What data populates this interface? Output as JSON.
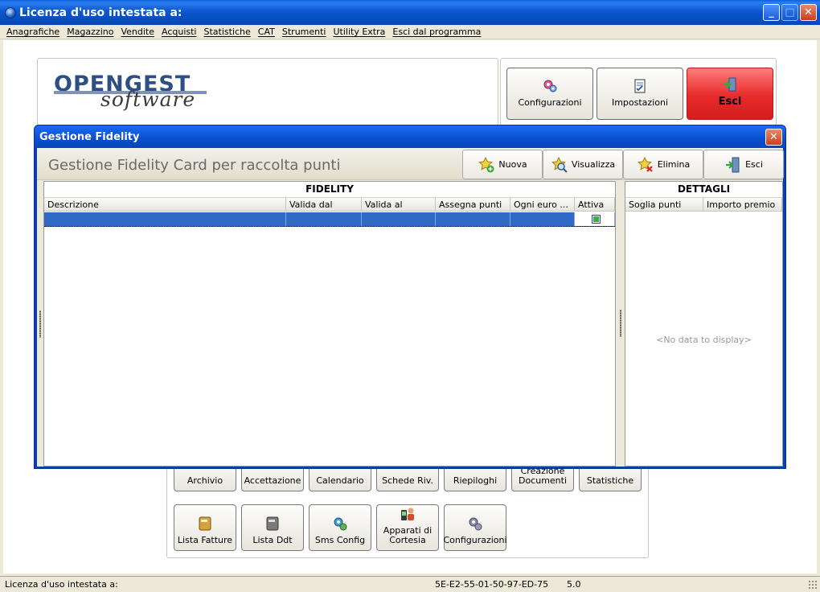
{
  "main_window": {
    "title": "Licenza d'uso intestata a:",
    "controls": {
      "minimize": "_",
      "maximize": "□",
      "close": "✕"
    }
  },
  "menu": {
    "items": [
      "Anagrafiche",
      "Magazzino",
      "Vendite",
      "Acquisti",
      "Statistiche",
      "CAT",
      "Strumenti",
      "Utility Extra",
      "Esci dal programma"
    ]
  },
  "logo": {
    "line1": "OPENGEST",
    "line2": "software"
  },
  "top_buttons": [
    {
      "label": "Configurazioni",
      "icon": "gears-icon"
    },
    {
      "label": "Impostazioni",
      "icon": "checklist-icon"
    },
    {
      "label": "Esci",
      "icon": "exit-door-icon"
    }
  ],
  "bottom_buttons": {
    "row1": [
      "Archivio",
      "Accettazione",
      "Calendario",
      "Schede Riv.",
      "Riepiloghi",
      "Creazione Documenti",
      "Statistiche"
    ],
    "row2": [
      "Lista Fatture",
      "Lista Ddt",
      "Sms Config",
      "Apparati di Cortesia",
      "Configurazioni"
    ]
  },
  "status": {
    "license": "Licenza d'uso intestata a:",
    "code": "5E-E2-55-01-50-97-ED-75",
    "version": "5.0"
  },
  "dialog": {
    "title": "Gestione Fidelity",
    "close": "✕",
    "header_title": "Gestione Fidelity Card per raccolta punti",
    "toolbar": [
      {
        "label": "Nuova",
        "icon": "star-add-icon"
      },
      {
        "label": "Visualizza",
        "icon": "star-search-icon"
      },
      {
        "label": "Elimina",
        "icon": "star-delete-icon"
      },
      {
        "label": "Esci",
        "icon": "exit-door-icon"
      }
    ],
    "fidelity_panel": {
      "title": "FIDELITY",
      "columns": [
        "Descrizione",
        "Valida dal",
        "Valida al",
        "Assegna punti",
        "Ogni euro ...",
        "Attiva"
      ],
      "rows": [
        {
          "descrizione": "",
          "valida_dal": "",
          "valida_al": "",
          "assegna_punti": "",
          "ogni_euro": "",
          "attiva": true
        }
      ]
    },
    "details_panel": {
      "title": "DETTAGLI",
      "columns": [
        "Soglia punti",
        "Importo premio"
      ],
      "empty_text": "<No data to display>"
    }
  },
  "colors": {
    "titlebar_blue": "#0b57d0",
    "selection_blue": "#3169c6",
    "exit_red": "#e82a2a",
    "background": "#ece9d8"
  }
}
